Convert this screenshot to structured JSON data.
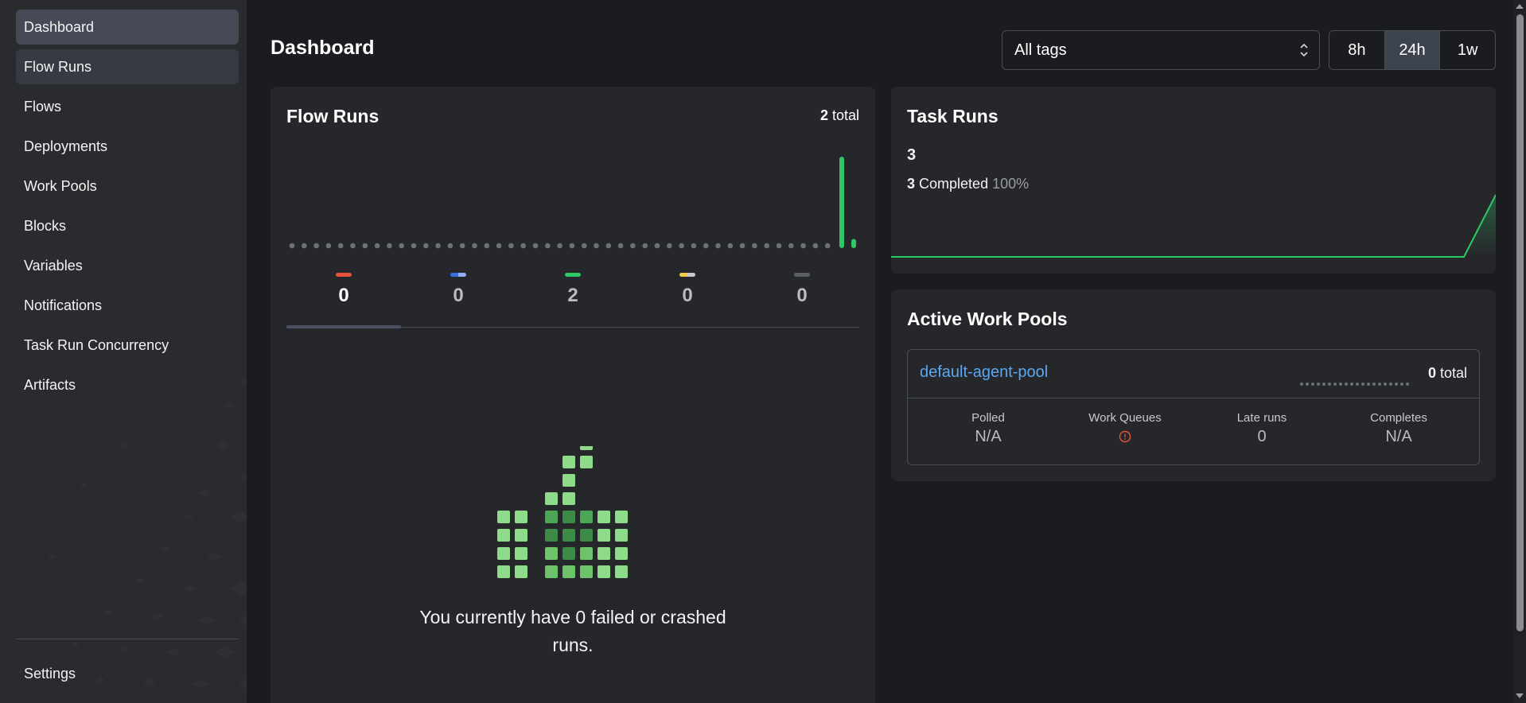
{
  "sidebar": {
    "items": [
      {
        "label": "Dashboard",
        "name": "sidebar-item-dashboard"
      },
      {
        "label": "Flow Runs",
        "name": "sidebar-item-flow-runs"
      },
      {
        "label": "Flows",
        "name": "sidebar-item-flows"
      },
      {
        "label": "Deployments",
        "name": "sidebar-item-deployments"
      },
      {
        "label": "Work Pools",
        "name": "sidebar-item-work-pools"
      },
      {
        "label": "Blocks",
        "name": "sidebar-item-blocks"
      },
      {
        "label": "Variables",
        "name": "sidebar-item-variables"
      },
      {
        "label": "Notifications",
        "name": "sidebar-item-notifications"
      },
      {
        "label": "Task Run Concurrency",
        "name": "sidebar-item-task-run-concurrency"
      },
      {
        "label": "Artifacts",
        "name": "sidebar-item-artifacts"
      }
    ],
    "settings_label": "Settings"
  },
  "header": {
    "title": "Dashboard",
    "tag_filter": "All tags",
    "ranges": [
      "8h",
      "24h",
      "1w"
    ],
    "selected_range": "24h"
  },
  "flow_runs": {
    "title": "Flow Runs",
    "total_count": "2",
    "total_suffix": "total",
    "history_bars": [
      1.0,
      0.1
    ],
    "states": [
      {
        "name": "failed",
        "count": "0",
        "color": "#e5533d"
      },
      {
        "name": "running",
        "count": "0",
        "color": "#3b6fe0"
      },
      {
        "name": "completed",
        "count": "2",
        "color": "#2ec866"
      },
      {
        "name": "late",
        "count": "0",
        "color": "#f2c94c"
      },
      {
        "name": "other",
        "count": "0",
        "color": "#5b5e66"
      }
    ],
    "empty_message": "You currently have 0 failed or crashed runs."
  },
  "task_runs": {
    "title": "Task Runs",
    "count": "3",
    "completed_count": "3",
    "completed_label": "Completed",
    "completed_percent": "100%",
    "line_color": "#2ec866"
  },
  "work_pools": {
    "title": "Active Work Pools",
    "pool_name": "default-agent-pool",
    "total_count": "0",
    "total_suffix": "total",
    "stats": [
      {
        "label": "Polled",
        "value": "N/A"
      },
      {
        "label": "Work Queues",
        "value": "",
        "icon": "alert-circle-icon"
      },
      {
        "label": "Late runs",
        "value": "0"
      },
      {
        "label": "Completes",
        "value": "N/A"
      }
    ]
  },
  "colors": {
    "accent": "#2ec866",
    "link": "#5ba7f0",
    "error": "#e5533d"
  }
}
